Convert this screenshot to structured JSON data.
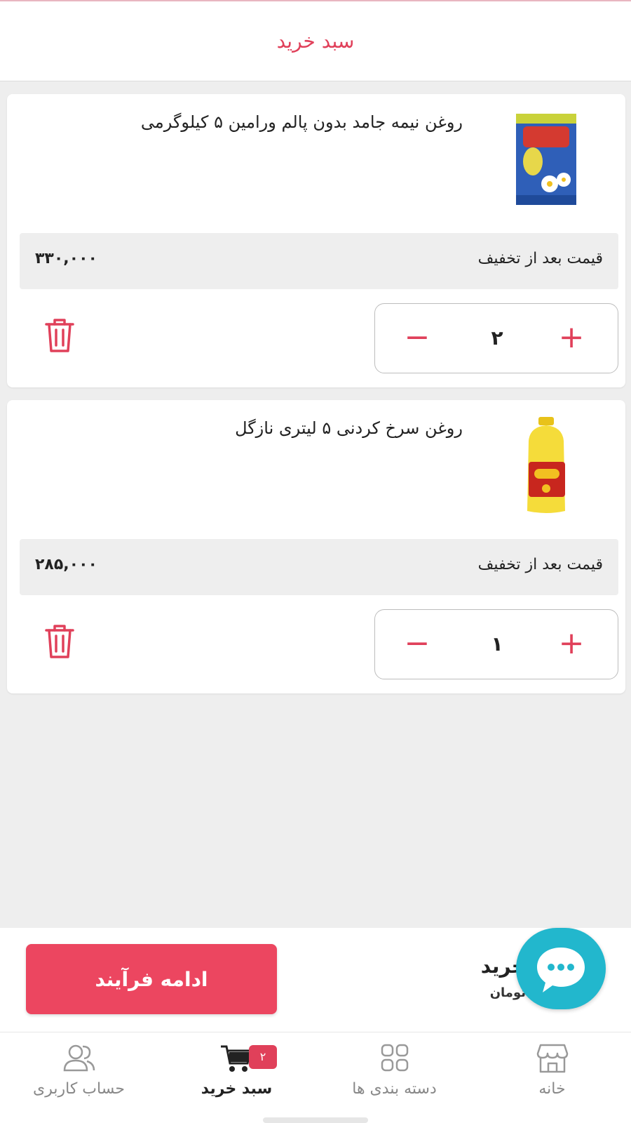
{
  "header": {
    "title": "سبد خرید"
  },
  "cart": {
    "items": [
      {
        "name": "روغن نیمه جامد بدون پالم ورامین ۵ کیلوگرمی",
        "price_label": "قیمت بعد از تخفیف",
        "price": "۳۳۰,۰۰۰",
        "quantity": "۲",
        "image": "product-tin-icon"
      },
      {
        "name": "روغن سرخ کردنی ۵ لیتری نازگل",
        "price_label": "قیمت بعد از تخفیف",
        "price": "۲۸۵,۰۰۰",
        "quantity": "۱",
        "image": "product-bottle-icon"
      }
    ],
    "plus_symbol": "+",
    "minus_symbol": "−"
  },
  "summary": {
    "label": "خرید",
    "sub": "تومان",
    "continue_label": "ادامه فرآیند"
  },
  "chat": {
    "icon": "chat-bubble-icon"
  },
  "nav": {
    "items": [
      {
        "label": "خانه",
        "icon": "store-icon"
      },
      {
        "label": "دسته بندی ها",
        "icon": "grid-icon"
      },
      {
        "label": "سبد خرید",
        "icon": "cart-icon",
        "badge": "۲"
      },
      {
        "label": "حساب کاربری",
        "icon": "users-icon"
      }
    ]
  },
  "colors": {
    "accent": "#e0405a",
    "button": "#ec4660",
    "chat": "#22b7cd",
    "background": "#eeeeee"
  }
}
